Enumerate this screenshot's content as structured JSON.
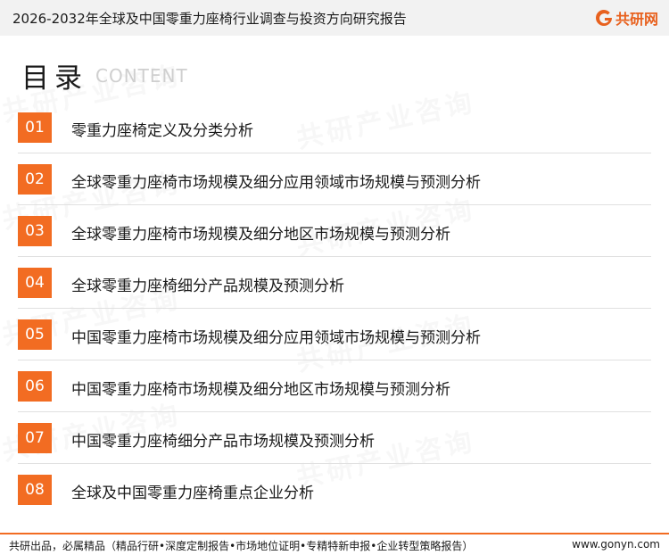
{
  "header": {
    "title": "2026-2032年全球及中国零重力座椅行业调查与投资方向研究报告",
    "brand": "共研网"
  },
  "toc": {
    "title": "目录",
    "subtitle": "CONTENT",
    "items": [
      {
        "num": "01",
        "label": "零重力座椅定义及分类分析"
      },
      {
        "num": "02",
        "label": "全球零重力座椅市场规模及细分应用领域市场规模与预测分析"
      },
      {
        "num": "03",
        "label": "全球零重力座椅市场规模及细分地区市场规模与预测分析"
      },
      {
        "num": "04",
        "label": "全球零重力座椅细分产品规模及预测分析"
      },
      {
        "num": "05",
        "label": "中国零重力座椅市场规模及细分应用领域市场规模与预测分析"
      },
      {
        "num": "06",
        "label": "中国零重力座椅市场规模及细分地区市场规模与预测分析"
      },
      {
        "num": "07",
        "label": "中国零重力座椅细分产品市场规模及预测分析"
      },
      {
        "num": "08",
        "label": "全球及中国零重力座椅重点企业分析"
      }
    ]
  },
  "watermark": {
    "text": "共研产业咨询"
  },
  "footer": {
    "slogan": "共研出品，必属精品（精品行研•深度定制报告•市场地位证明•专精特新申报•企业转型策略报告）",
    "url": "www.gonyn.com"
  },
  "colors": {
    "accent": "#f26c22"
  }
}
